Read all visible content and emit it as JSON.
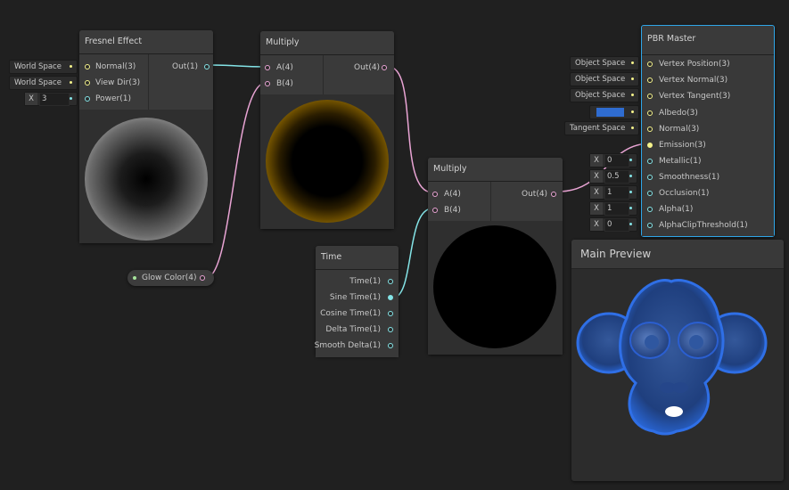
{
  "fresnel": {
    "title": "Fresnel Effect",
    "inputs": [
      "Normal(3)",
      "View Dir(3)",
      "Power(1)"
    ],
    "output": "Out(1)",
    "normal_space": "World Space",
    "viewdir_space": "World Space",
    "power_x": "X",
    "power_value": "3"
  },
  "multiply1": {
    "title": "Multiply",
    "inputs": [
      "A(4)",
      "B(4)"
    ],
    "output": "Out(4)"
  },
  "multiply2": {
    "title": "Multiply",
    "inputs": [
      "A(4)",
      "B(4)"
    ],
    "output": "Out(4)"
  },
  "glow": {
    "label": "Glow Color(4)"
  },
  "time": {
    "title": "Time",
    "outputs": [
      "Time(1)",
      "Sine Time(1)",
      "Cosine Time(1)",
      "Delta Time(1)",
      "Smooth Delta(1)"
    ]
  },
  "master": {
    "title": "PBR Master",
    "inputs": [
      "Vertex Position(3)",
      "Vertex Normal(3)",
      "Vertex Tangent(3)",
      "Albedo(3)",
      "Normal(3)",
      "Emission(3)",
      "Metallic(1)",
      "Smoothness(1)",
      "Occlusion(1)",
      "Alpha(1)",
      "AlphaClipThreshold(1)"
    ],
    "pos_space": "Object Space",
    "normal_space": "Object Space",
    "tangent_space": "Object Space",
    "normal_map_space": "Tangent Space",
    "albedo_color": "#2f6cd0",
    "x": "X",
    "metallic": "0",
    "smoothness": "0.5",
    "occlusion": "1",
    "alpha": "1",
    "alpha_clip": "0"
  },
  "main_preview": {
    "title": "Main Preview"
  },
  "colors": {
    "accent": "#2fa6e8",
    "glow": "#f0b400",
    "albedo": "#2f6cd0"
  }
}
